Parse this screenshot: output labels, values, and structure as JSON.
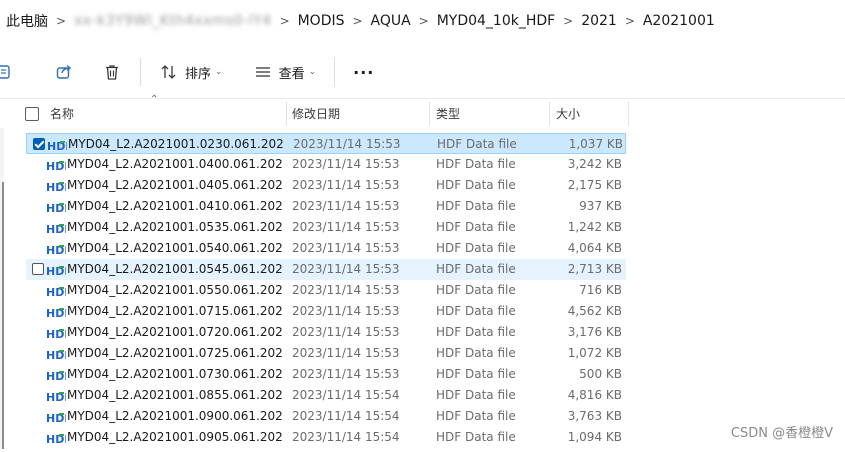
{
  "breadcrumb": {
    "items": [
      "此电脑",
      "xx-k3Y9Wl_Kth4xxms0-lY4",
      "MODIS",
      "AQUA",
      "MYD04_10k_HDF",
      "2021",
      "A2021001"
    ]
  },
  "toolbar": {
    "sort_label": "排序",
    "view_label": "查看",
    "more_label": "···"
  },
  "columns": {
    "name": "名称",
    "date": "修改日期",
    "type": "类型",
    "size": "大小"
  },
  "icon_label": "HDF",
  "files": [
    {
      "name": "MYD04_L2.A2021001.0230.061.202...",
      "date": "2023/11/14 15:53",
      "type": "HDF Data file",
      "size": "1,037 KB",
      "state": "selected"
    },
    {
      "name": "MYD04_L2.A2021001.0400.061.202...",
      "date": "2023/11/14 15:53",
      "type": "HDF Data file",
      "size": "3,242 KB",
      "state": ""
    },
    {
      "name": "MYD04_L2.A2021001.0405.061.202...",
      "date": "2023/11/14 15:53",
      "type": "HDF Data file",
      "size": "2,175 KB",
      "state": ""
    },
    {
      "name": "MYD04_L2.A2021001.0410.061.202...",
      "date": "2023/11/14 15:53",
      "type": "HDF Data file",
      "size": "937 KB",
      "state": ""
    },
    {
      "name": "MYD04_L2.A2021001.0535.061.202...",
      "date": "2023/11/14 15:53",
      "type": "HDF Data file",
      "size": "1,242 KB",
      "state": ""
    },
    {
      "name": "MYD04_L2.A2021001.0540.061.202...",
      "date": "2023/11/14 15:53",
      "type": "HDF Data file",
      "size": "4,064 KB",
      "state": ""
    },
    {
      "name": "MYD04_L2.A2021001.0545.061.202...",
      "date": "2023/11/14 15:53",
      "type": "HDF Data file",
      "size": "2,713 KB",
      "state": "hover"
    },
    {
      "name": "MYD04_L2.A2021001.0550.061.202...",
      "date": "2023/11/14 15:53",
      "type": "HDF Data file",
      "size": "716 KB",
      "state": ""
    },
    {
      "name": "MYD04_L2.A2021001.0715.061.202...",
      "date": "2023/11/14 15:53",
      "type": "HDF Data file",
      "size": "4,562 KB",
      "state": ""
    },
    {
      "name": "MYD04_L2.A2021001.0720.061.202...",
      "date": "2023/11/14 15:53",
      "type": "HDF Data file",
      "size": "3,176 KB",
      "state": ""
    },
    {
      "name": "MYD04_L2.A2021001.0725.061.202...",
      "date": "2023/11/14 15:53",
      "type": "HDF Data file",
      "size": "1,072 KB",
      "state": ""
    },
    {
      "name": "MYD04_L2.A2021001.0730.061.202...",
      "date": "2023/11/14 15:53",
      "type": "HDF Data file",
      "size": "500 KB",
      "state": ""
    },
    {
      "name": "MYD04_L2.A2021001.0855.061.202...",
      "date": "2023/11/14 15:54",
      "type": "HDF Data file",
      "size": "4,816 KB",
      "state": ""
    },
    {
      "name": "MYD04_L2.A2021001.0900.061.202...",
      "date": "2023/11/14 15:54",
      "type": "HDF Data file",
      "size": "3,763 KB",
      "state": ""
    },
    {
      "name": "MYD04_L2.A2021001.0905.061.202...",
      "date": "2023/11/14 15:54",
      "type": "HDF Data file",
      "size": "1,094 KB",
      "state": ""
    }
  ],
  "watermark": "CSDN @香橙橙V",
  "colors": {
    "selection_bg": "#cce8ff",
    "selection_border": "#99d1ff",
    "hover_bg": "#e5f3ff",
    "accent": "#005fb8",
    "icon_blue": "#1e63c8",
    "icon_green": "#2aa84a"
  }
}
